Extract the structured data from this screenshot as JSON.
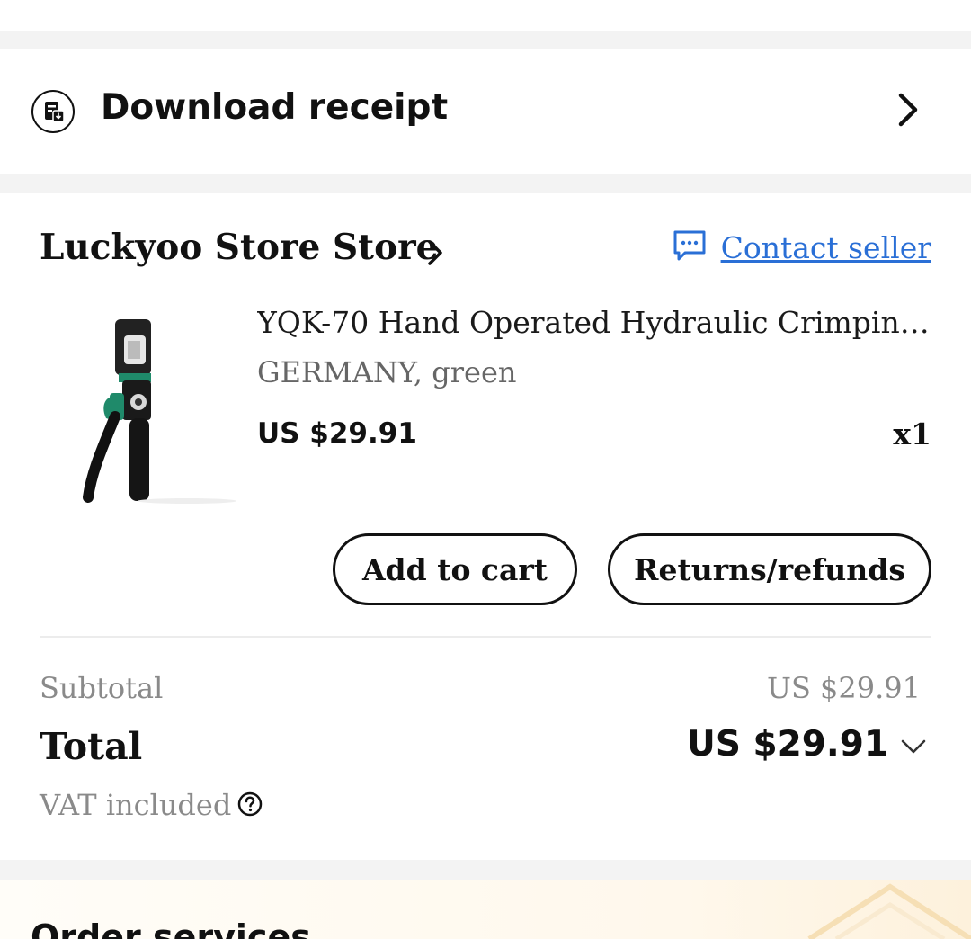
{
  "receipt": {
    "label": "Download receipt",
    "icon": "receipt-icon"
  },
  "store": {
    "name": "Luckyoo Store Store",
    "contact_label": "Contact seller",
    "contact_icon": "chat-icon"
  },
  "product": {
    "title": "YQK-70 Hand Operated Hydraulic Crimping Tool",
    "variant": "GERMANY, green",
    "price": "US $29.91",
    "quantity": "x1",
    "image_icon": "hydraulic-crimping-tool-image"
  },
  "actions": {
    "add_to_cart": "Add to cart",
    "returns": "Returns/refunds"
  },
  "summary": {
    "subtotal_label": "Subtotal",
    "subtotal_value": "US $29.91",
    "total_label": "Total",
    "total_value": "US $29.91",
    "vat_label": "VAT included"
  },
  "services": {
    "title": "Order services"
  },
  "colors": {
    "link": "#2a6fd6",
    "text": "#111111",
    "muted": "#8a8a8a",
    "tool_green": "#1f8a6a"
  }
}
